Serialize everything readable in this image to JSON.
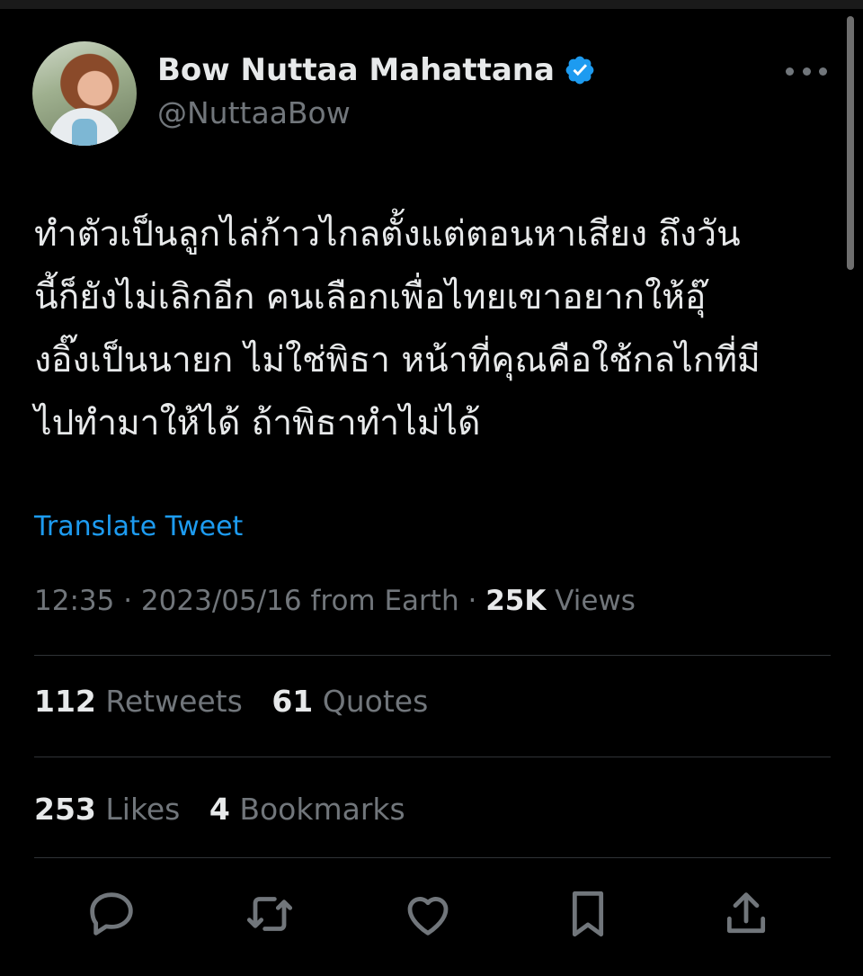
{
  "author": {
    "name": "Bow Nuttaa Mahattana",
    "handle": "@NuttaaBow"
  },
  "tweet": {
    "lines": [
      "ทำตัวเป็นลูกไล่ก้าวไกลตั้งแต่ตอนหาเสียง ถึงวัน",
      "นี้ก็ยังไม่เลิกอีก คนเลือกเพื่อไทยเขาอยากให้อุ๊",
      "งอิ๊งเป็นนายก ไม่ใช่พิธา หน้าที่คุณคือใช้กลไกที่มี",
      "ไปทำมาให้ได้ ถ้าพิธาทำไม่ได้"
    ],
    "translate_label": "Translate Tweet",
    "meta": {
      "time": "12:35",
      "date": "2023/05/16",
      "source": "from Earth",
      "views_count": "25K",
      "views_label": "Views",
      "separator": "·"
    },
    "stats": {
      "retweets_count": "112",
      "retweets_label": "Retweets",
      "quotes_count": "61",
      "quotes_label": "Quotes",
      "likes_count": "253",
      "likes_label": "Likes",
      "bookmarks_count": "4",
      "bookmarks_label": "Bookmarks"
    }
  },
  "colors": {
    "background": "#000000",
    "text": "#e7e9ea",
    "secondary": "#71767b",
    "accent": "#1d9bf0",
    "divider": "#2f3336"
  },
  "icons": [
    "verified-badge-icon",
    "more-icon",
    "reply-icon",
    "retweet-icon",
    "like-icon",
    "bookmark-icon",
    "share-icon"
  ]
}
